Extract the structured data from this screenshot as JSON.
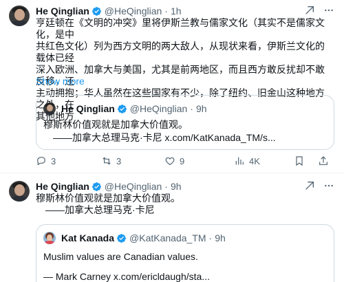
{
  "tweet1": {
    "author": {
      "name": "He Qinglian",
      "handle": "@HeQinglian",
      "time": "1h"
    },
    "text_lines": [
      "亨廷顿在《文明的冲突》里将伊斯兰教与儒家文化（其实不是儒家文化，是中",
      "共红色文化）列为西方文明的两大敌人，从现状来看，伊斯兰文化的载体已经",
      "深入欧洲、加拿大与美国，尤其是前两地区，而且西方敢反扰却不敢反移，还",
      "主动拥抱；华人虽然在这些国家有不少，除了纽约、旧金山这种地方之外，在",
      "其他地方"
    ],
    "show_more": "Show more",
    "quote": {
      "author": {
        "name": "He Qinglian",
        "handle": "@HeQinglian",
        "time": "9h"
      },
      "lines": [
        "穆斯林价值观就是加拿大价值观。",
        "——加拿大总理马克·卡尼 x.com/KatKanada_TM/s..."
      ]
    },
    "actions": {
      "replies": "3",
      "reposts": "3",
      "likes": "9",
      "views": "4K"
    }
  },
  "tweet2": {
    "author": {
      "name": "He Qinglian",
      "handle": "@HeQinglian",
      "time": "9h"
    },
    "text_lines": [
      "穆斯林价值观就是加拿大价值观。",
      "——加拿大总理马克·卡尼"
    ],
    "quote": {
      "author": {
        "name": "Kat Kanada",
        "handle": "@KatKanada_TM",
        "time": "9h"
      },
      "lines": [
        "Muslim values are Canadian values.",
        "— Mark Carney x.com/ericldaugh/sta..."
      ]
    },
    "separator": "·"
  },
  "colors": {
    "accent": "#1d9bf0",
    "muted": "#536471",
    "text": "#0f1419",
    "border": "#cfd9de"
  },
  "icons": [
    "verified-badge-icon",
    "grok-icon",
    "more-icon",
    "reply-icon",
    "repost-icon",
    "like-icon",
    "views-icon",
    "bookmark-icon",
    "share-icon"
  ]
}
